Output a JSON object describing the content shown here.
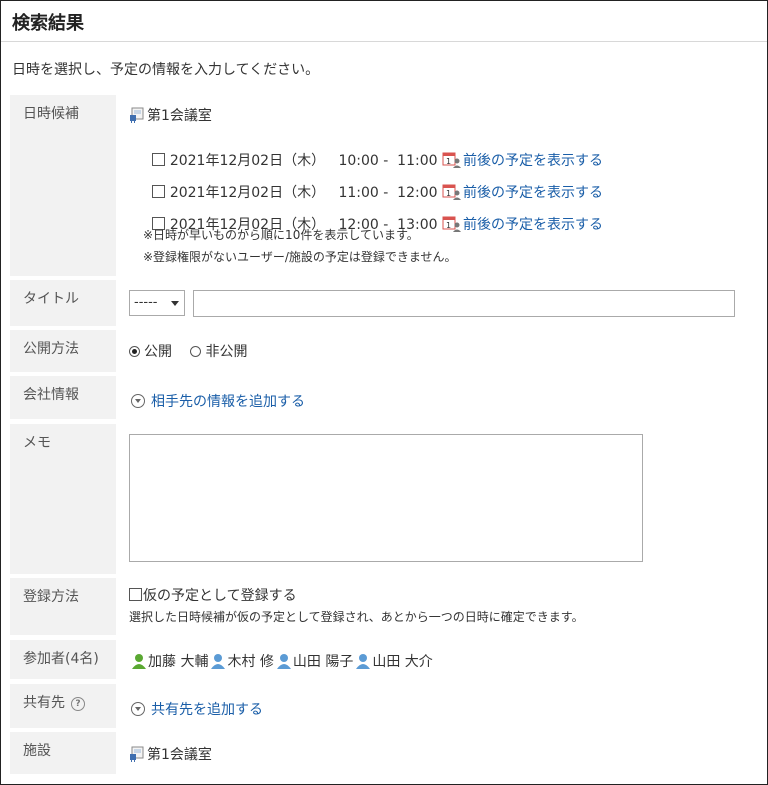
{
  "header": {
    "title": "検索結果",
    "instruction": "日時を選択し、予定の情報を入力してください。"
  },
  "fields": {
    "candidates": {
      "label": "日時候補",
      "facility": "第1会議室",
      "slots": [
        {
          "date": "2021年12月02日（木）",
          "time": "10:00 -  11:00",
          "link": "前後の予定を表示する",
          "checked": false
        },
        {
          "date": "2021年12月02日（木）",
          "time": "11:00 -  12:00",
          "link": "前後の予定を表示する",
          "checked": false
        },
        {
          "date": "2021年12月02日（木）",
          "time": "12:00 -  13:00",
          "link": "前後の予定を表示する",
          "checked": false
        }
      ],
      "notes": [
        "※日時が早いものから順に10件を表示しています。",
        "※登録権限がないユーザー/施設の予定は登録できません。"
      ]
    },
    "title": {
      "label": "タイトル",
      "select_value": "-----",
      "input_value": ""
    },
    "visibility": {
      "label": "公開方法",
      "options": [
        "公開",
        "非公開"
      ],
      "selected": "公開"
    },
    "company": {
      "label": "会社情報",
      "link": "相手先の情報を追加する"
    },
    "memo": {
      "label": "メモ",
      "value": ""
    },
    "registration": {
      "label": "登録方法",
      "checkbox_label": "仮の予定として登録する",
      "checked": false,
      "hint": "選択した日時候補が仮の予定として登録され、あとから一つの日時に確定できます。"
    },
    "participants": {
      "label": "参加者(4名)",
      "people": [
        "加藤 大輔",
        "木村 修",
        "山田 陽子",
        "山田 大介"
      ]
    },
    "share": {
      "label": "共有先",
      "help": "?",
      "link": "共有先を追加する"
    },
    "facility": {
      "label": "施設",
      "value": "第1会議室"
    }
  },
  "colors": {
    "link": "#1a5ea8",
    "label_bg": "#f2f2f2",
    "user_first": "#5aa832",
    "user_other": "#5b9bd5"
  }
}
